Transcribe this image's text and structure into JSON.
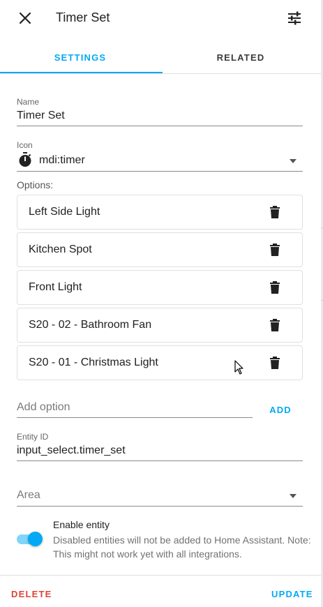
{
  "header": {
    "title": "Timer Set",
    "close_icon": "close-icon",
    "settings_icon": "tune-icon"
  },
  "tabs": [
    {
      "label": "SETTINGS",
      "active": true
    },
    {
      "label": "RELATED",
      "active": false
    }
  ],
  "name_field": {
    "label": "Name",
    "value": "Timer Set"
  },
  "icon_field": {
    "label": "Icon",
    "value": "mdi:timer",
    "icon": "timer-icon"
  },
  "options_section": {
    "label": "Options:",
    "items": [
      {
        "label": "Left Side Light"
      },
      {
        "label": "Kitchen Spot"
      },
      {
        "label": "Front Light"
      },
      {
        "label": "S20 - 02 - Bathroom Fan"
      },
      {
        "label": "S20 - 01 - Christmas Light"
      }
    ]
  },
  "add_option": {
    "placeholder": "Add option",
    "button_label": "ADD"
  },
  "entity_id_field": {
    "label": "Entity ID",
    "value": "input_select.timer_set"
  },
  "area_field": {
    "placeholder": "Area"
  },
  "enable_entity": {
    "title": "Enable entity",
    "description": "Disabled entities will not be added to Home Assistant. Note: This might not work yet with all integrations.",
    "enabled": true
  },
  "footer": {
    "delete_label": "DELETE",
    "update_label": "UPDATE"
  },
  "colors": {
    "accent": "#03a9f4",
    "danger": "#db4437",
    "text": "#212121",
    "muted": "#727272"
  }
}
